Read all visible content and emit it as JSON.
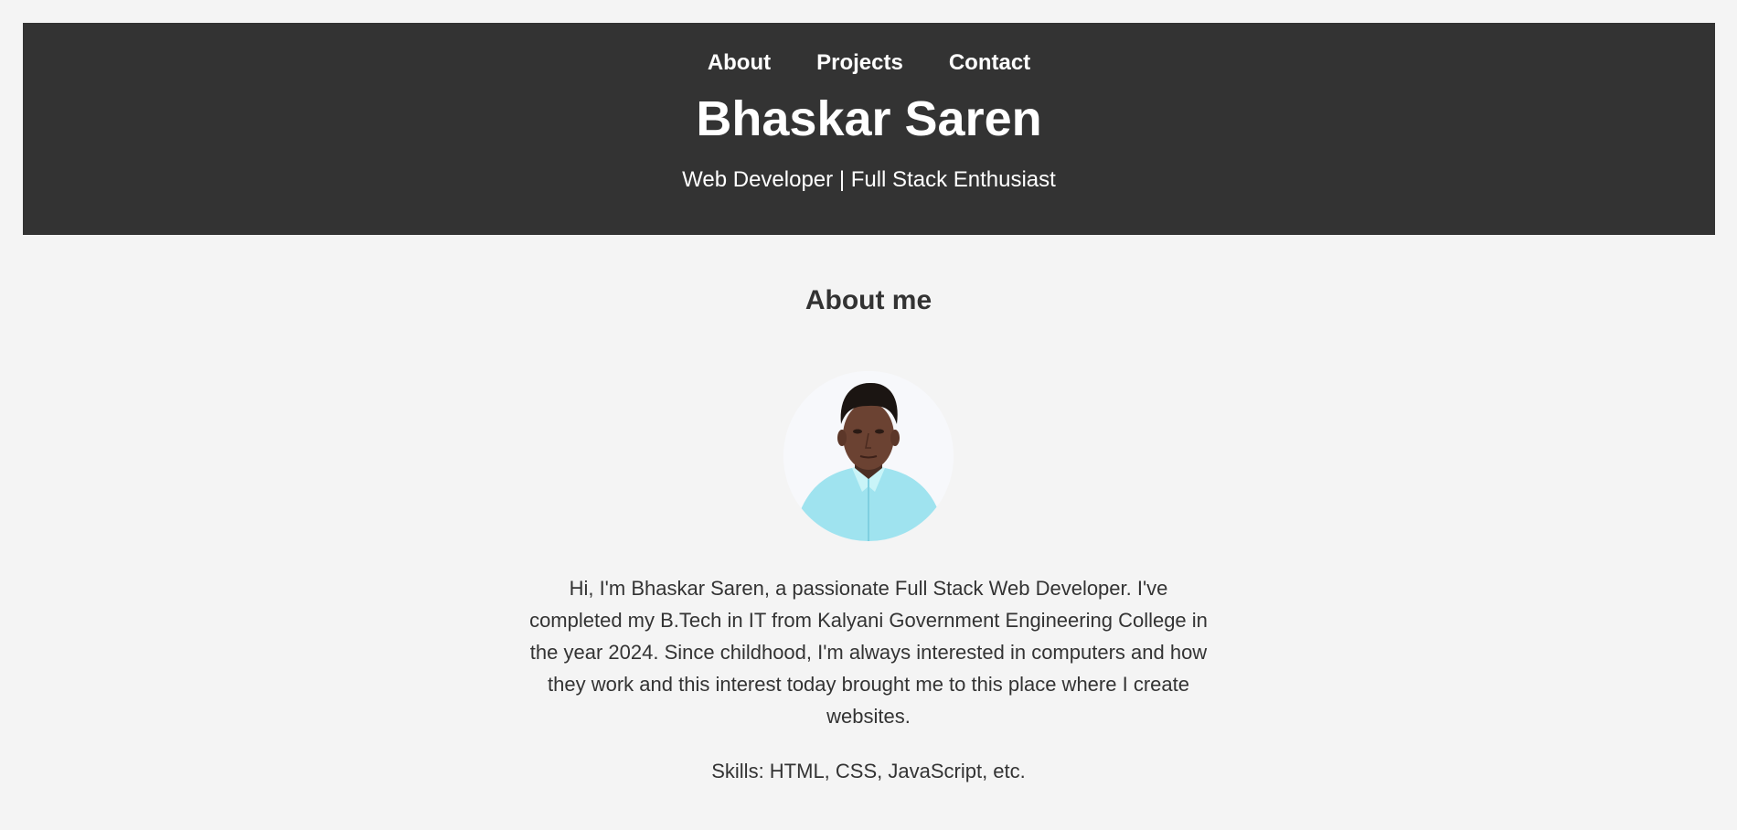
{
  "header": {
    "nav": [
      {
        "label": "About"
      },
      {
        "label": "Projects"
      },
      {
        "label": "Contact"
      }
    ],
    "title": "Bhaskar Saren",
    "tagline": "Web Developer | Full Stack Enthusiast"
  },
  "about": {
    "heading": "About me",
    "avatar_icon": "profile-photo",
    "bio": "Hi, I'm Bhaskar Saren, a passionate Full Stack Web Developer. I've completed my B.Tech in IT from Kalyani Government Engineering College in the year 2024. Since childhood, I'm always interested in computers and how they work and this interest today brought me to this place where I create websites.",
    "skills": "Skills: HTML, CSS, JavaScript, etc."
  },
  "colors": {
    "page_background": "#f4f4f4",
    "header_background": "#333333",
    "header_text": "#ffffff",
    "body_text": "#333333",
    "shirt": "#9fe3ef"
  }
}
